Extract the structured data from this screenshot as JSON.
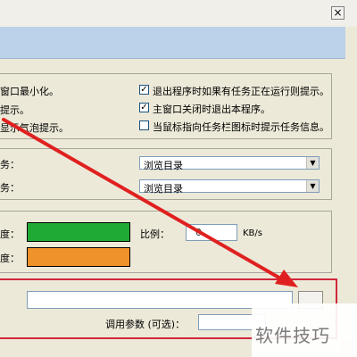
{
  "window": {
    "close_glyph": "×"
  },
  "general": {
    "left_options": [
      "窗口最小化。",
      "提示。",
      "显示气泡提示。"
    ],
    "right_options": [
      {
        "label": "退出程序时如果有任务正在运行则提示。",
        "checked": true
      },
      {
        "label": "主窗口关闭时退出本程序。",
        "checked": true
      },
      {
        "label": "当鼠标指向任务栏图标时提示任务信息。",
        "checked": false
      }
    ]
  },
  "actions": {
    "rows": [
      {
        "label": "务：",
        "value": "浏览目录"
      },
      {
        "label": "务：",
        "value": "浏览目录"
      }
    ]
  },
  "speed": {
    "rows": [
      {
        "label": "度：",
        "color": "#1faa35"
      },
      {
        "label": "度：",
        "color": "#f0922a"
      }
    ],
    "ratio_label": "比例：",
    "ratio_value": "0",
    "unit": "KB/s"
  },
  "player": {
    "params_label": "调用参数 (可选)："
  },
  "watermark": {
    "text": "软件技巧"
  },
  "annotation": {
    "arrow_color": "#e02020",
    "box_color": "#d2283c"
  }
}
